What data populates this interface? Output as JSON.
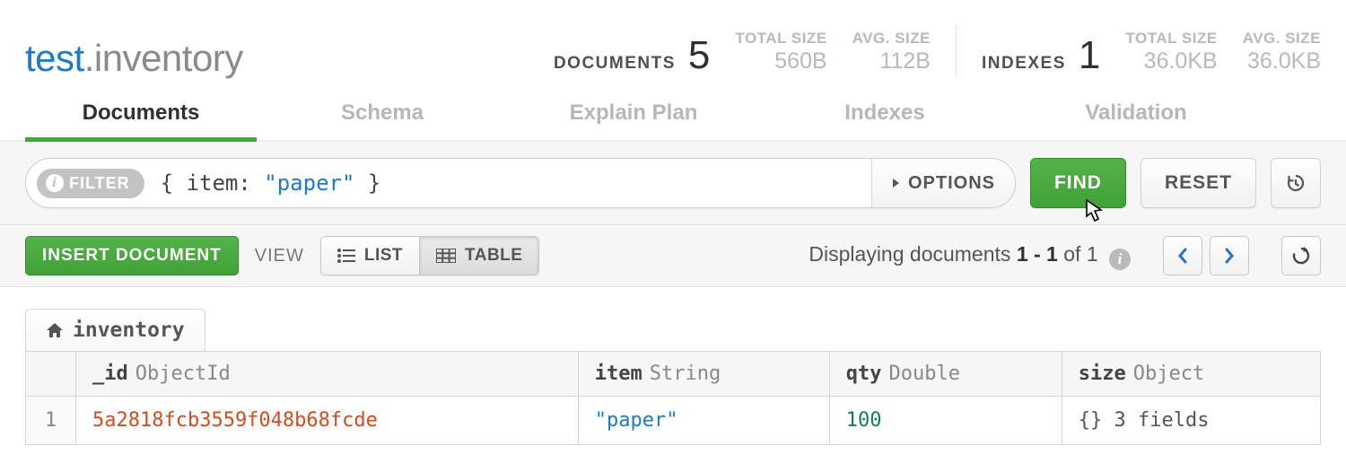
{
  "namespace": {
    "db": "test",
    "dot": ".",
    "coll": "inventory"
  },
  "stats": {
    "documents": {
      "label": "DOCUMENTS",
      "count": "5",
      "total_size_label": "TOTAL SIZE",
      "total_size": "560B",
      "avg_size_label": "AVG. SIZE",
      "avg_size": "112B"
    },
    "indexes": {
      "label": "INDEXES",
      "count": "1",
      "total_size_label": "TOTAL SIZE",
      "total_size": "36.0KB",
      "avg_size_label": "AVG. SIZE",
      "avg_size": "36.0KB"
    }
  },
  "tabs": {
    "documents": "Documents",
    "schema": "Schema",
    "explain": "Explain Plan",
    "indexes": "Indexes",
    "validation": "Validation",
    "active": "documents"
  },
  "filter": {
    "badge": "FILTER",
    "query_parts": {
      "open": "{ ",
      "key": "item:",
      "space": " ",
      "value": "\"paper\"",
      "close": " }"
    },
    "options": "OPTIONS",
    "find": "FIND",
    "reset": "RESET"
  },
  "toolbar": {
    "insert": "INSERT DOCUMENT",
    "view": "VIEW",
    "list": "LIST",
    "table": "TABLE",
    "displaying_pre": "Displaying documents ",
    "displaying_range": "1 - 1",
    "displaying_mid": " of ",
    "displaying_total": "1"
  },
  "breadcrumb": "inventory",
  "columns": [
    {
      "name": "_id",
      "type": "ObjectId"
    },
    {
      "name": "item",
      "type": "String"
    },
    {
      "name": "qty",
      "type": "Double"
    },
    {
      "name": "size",
      "type": "Object"
    }
  ],
  "rows": [
    {
      "num": "1",
      "id": "5a2818fcb3559f048b68fcde",
      "item": "\"paper\"",
      "qty": "100",
      "size": "{} 3 fields"
    }
  ]
}
